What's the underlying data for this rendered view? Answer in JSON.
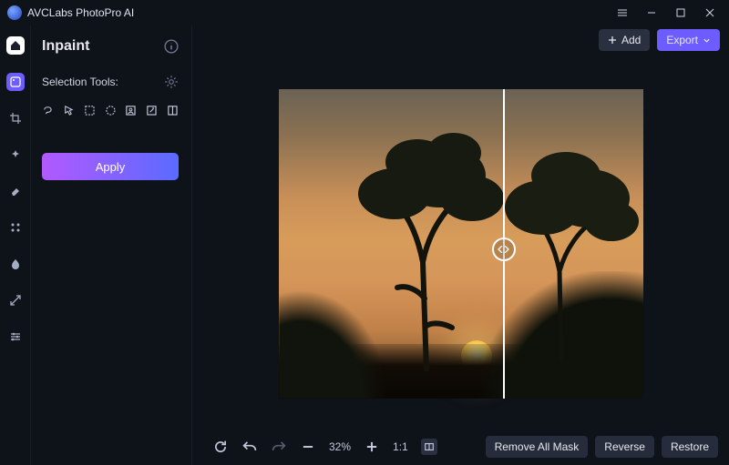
{
  "app": {
    "title": "AVCLabs PhotoPro AI"
  },
  "top": {
    "add_label": "Add",
    "export_label": "Export"
  },
  "sidebar": {
    "heading": "Inpaint",
    "selection_label": "Selection Tools:",
    "apply_label": "Apply"
  },
  "bottombar": {
    "zoom_pct": "32%",
    "oneToOne": "1:1",
    "remove_label": "Remove All Mask",
    "reverse_label": "Reverse",
    "restore_label": "Restore"
  }
}
